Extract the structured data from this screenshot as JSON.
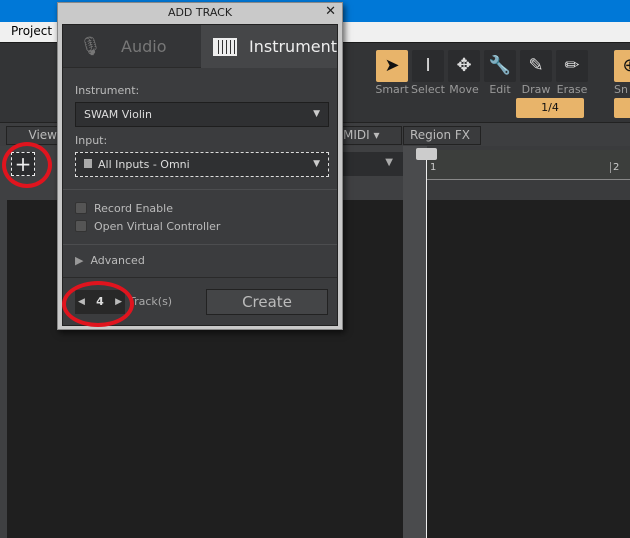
{
  "menubar": {
    "items": [
      "Project"
    ]
  },
  "toolbar": {
    "tools": [
      {
        "label": "Smart",
        "icon": "arrow-cursor-icon",
        "active": true
      },
      {
        "label": "Select",
        "icon": "i-beam-icon",
        "active": false
      },
      {
        "label": "Move",
        "icon": "move-arrows-icon",
        "active": false
      },
      {
        "label": "Edit",
        "icon": "wrench-icon",
        "active": false
      },
      {
        "label": "Draw",
        "icon": "pencil-icon",
        "active": false
      },
      {
        "label": "Erase",
        "icon": "eraser-icon",
        "active": false
      },
      {
        "label": "Sn",
        "icon": "snap-grid-icon",
        "active": true
      }
    ],
    "quantize": "1/4",
    "accent": "#e8b46a"
  },
  "tabbar": {
    "view": "View",
    "midi": "MIDI",
    "region_fx": "Region FX"
  },
  "ruler": {
    "marks": [
      "1",
      "2"
    ]
  },
  "dialog": {
    "title": "ADD TRACK",
    "tabs": [
      {
        "label": "Audio",
        "active": false
      },
      {
        "label": "Instrument",
        "active": true
      }
    ],
    "instrument_label": "Instrument:",
    "instrument_value": "SWAM Violin",
    "input_label": "Input:",
    "input_value": "All Inputs - Omni",
    "record_enable": {
      "label": "Record Enable",
      "checked": false
    },
    "virtual_controller": {
      "label": "Open Virtual Controller",
      "checked": false
    },
    "advanced": "Advanced",
    "track_count": "4",
    "track_count_label": "Track(s)",
    "create": "Create"
  }
}
